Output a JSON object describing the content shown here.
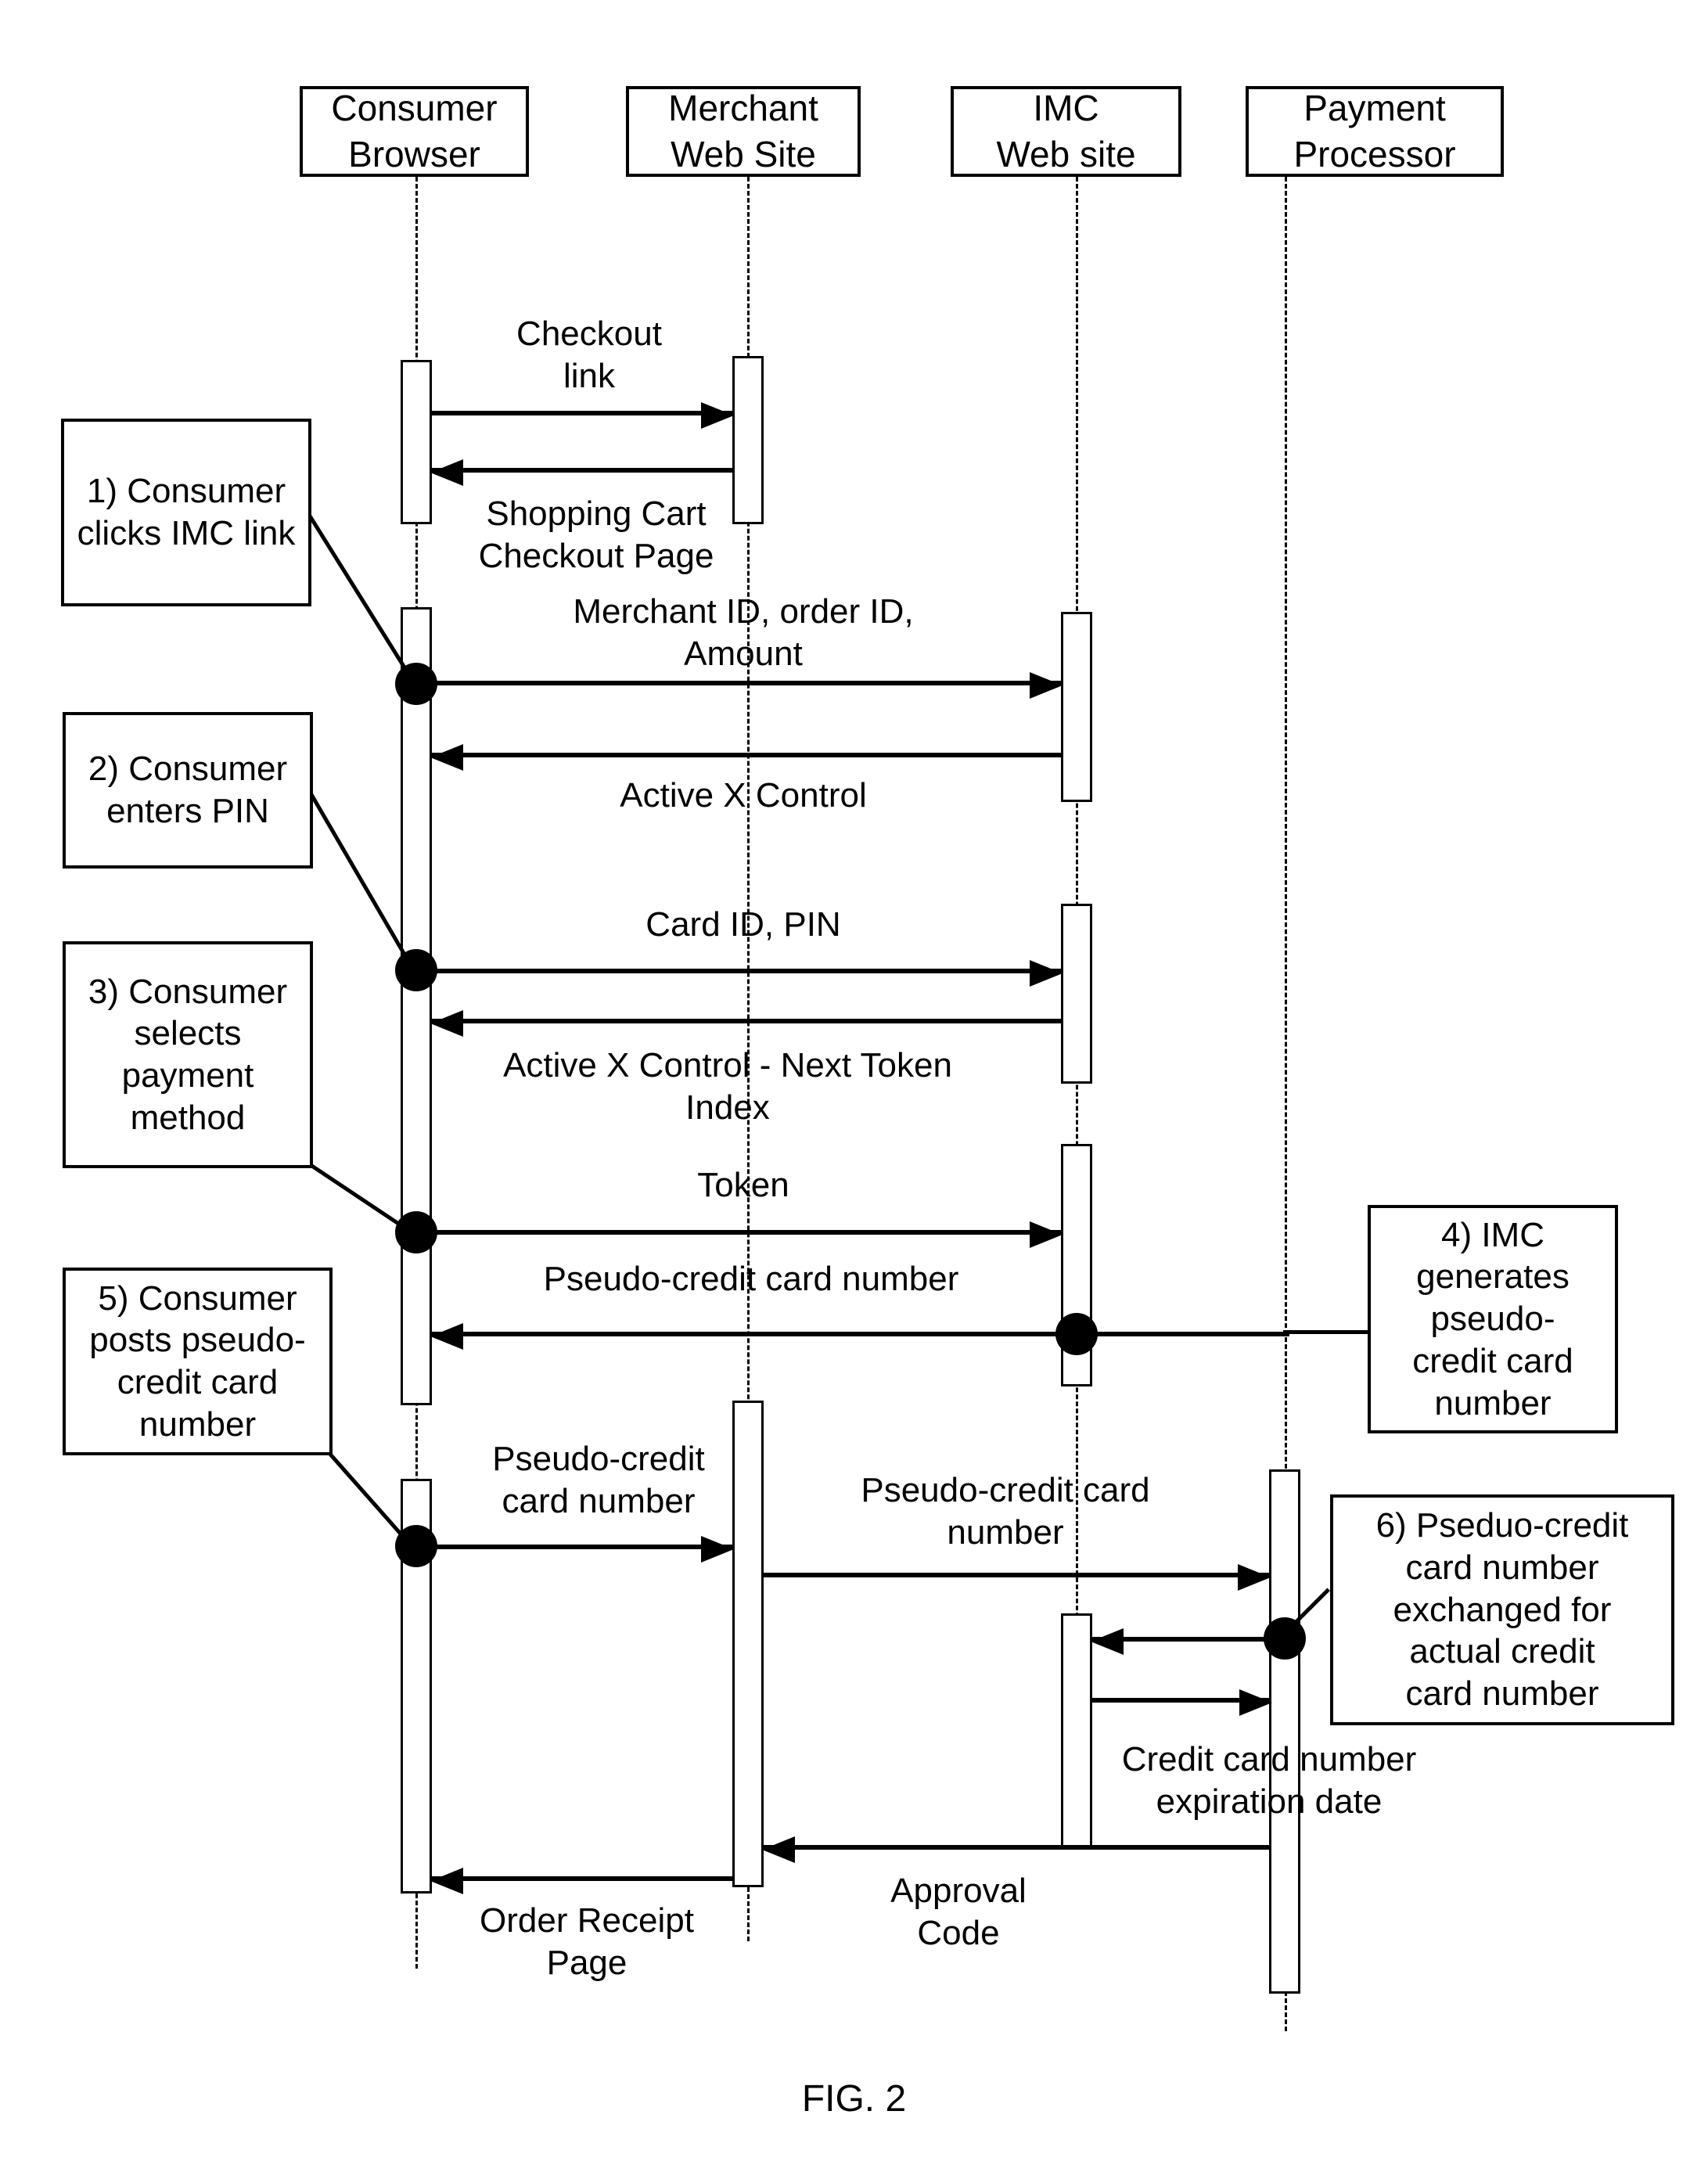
{
  "figure": {
    "caption": "FIG. 2",
    "type": "uml-sequence-diagram"
  },
  "actors": [
    {
      "id": "consumer",
      "line1": "Consumer",
      "line2": "Browser"
    },
    {
      "id": "merchant",
      "line1": "Merchant",
      "line2": "Web Site"
    },
    {
      "id": "imc",
      "line1": "IMC",
      "line2": "Web site"
    },
    {
      "id": "processor",
      "line1": "Payment",
      "line2": "Processor"
    }
  ],
  "messages": [
    {
      "id": "m1",
      "label": "Checkout\nlink",
      "from": "consumer",
      "to": "merchant"
    },
    {
      "id": "m2",
      "label": "Shopping Cart\nCheckout Page",
      "from": "merchant",
      "to": "consumer"
    },
    {
      "id": "m3",
      "label": "Merchant ID, order ID,\nAmount",
      "from": "consumer",
      "to": "imc"
    },
    {
      "id": "m4",
      "label": "Active X Control",
      "from": "imc",
      "to": "consumer"
    },
    {
      "id": "m5",
      "label": "Card ID, PIN",
      "from": "consumer",
      "to": "imc"
    },
    {
      "id": "m6",
      "label": "Active X Control  - Next Token\nIndex",
      "from": "imc",
      "to": "consumer"
    },
    {
      "id": "m7",
      "label": "Token",
      "from": "consumer",
      "to": "imc"
    },
    {
      "id": "m8",
      "label": "Pseudo-credit card number",
      "from": "imc",
      "to": "consumer"
    },
    {
      "id": "m9",
      "label": "Pseudo-credit\ncard number",
      "from": "consumer",
      "to": "merchant"
    },
    {
      "id": "m10",
      "label": "Pseudo-credit card\nnumber",
      "from": "merchant",
      "to": "processor"
    },
    {
      "id": "m11",
      "label": "",
      "from": "processor",
      "to": "imc"
    },
    {
      "id": "m12",
      "label": "Credit card number\nexpiration date",
      "from": "imc",
      "to": "processor"
    },
    {
      "id": "m13",
      "label": "Approval\nCode",
      "from": "processor",
      "to": "merchant"
    },
    {
      "id": "m14",
      "label": "Order Receipt\nPage",
      "from": "merchant",
      "to": "consumer"
    }
  ],
  "notes": [
    {
      "id": "n1",
      "text": "1) Consumer\nclicks IMC link"
    },
    {
      "id": "n2",
      "text": "2) Consumer\nenters PIN"
    },
    {
      "id": "n3",
      "text": "3) Consumer\nselects\npayment\nmethod"
    },
    {
      "id": "n5",
      "text": "5) Consumer\nposts pseudo-\ncredit card\nnumber"
    },
    {
      "id": "n4",
      "text": "4) IMC\ngenerates\npseudo-\ncredit card\nnumber"
    },
    {
      "id": "n6",
      "text": "6) Pseduo-credit\ncard number\nexchanged for\nactual credit\ncard number"
    }
  ],
  "colors": {
    "stroke": "#000000",
    "background": "#ffffff"
  }
}
